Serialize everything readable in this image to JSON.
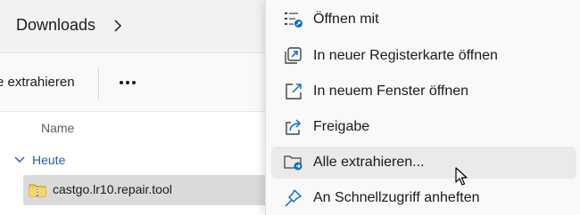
{
  "address_bar": {
    "current_folder": "Downloads",
    "chevron_icon": "chevron-right-icon"
  },
  "command_bar": {
    "extract_label": "e extrahieren",
    "more_icon": "more-dots-icon"
  },
  "file_list": {
    "column_name": "Name",
    "group_label": "Heute",
    "group_icon": "chevron-down-icon",
    "files": [
      {
        "name": "castgo.lr10.repair.tool",
        "icon": "zip-folder-icon",
        "selected": true
      }
    ]
  },
  "context_menu": {
    "items": [
      {
        "label": "Öffnen mit",
        "icon": "open-with-icon"
      },
      {
        "label": "In neuer Registerkarte öffnen",
        "icon": "new-tab-icon"
      },
      {
        "label": "In neuem Fenster öffnen",
        "icon": "new-window-icon"
      },
      {
        "label": "Freigabe",
        "icon": "share-icon"
      },
      {
        "label": "Alle extrahieren...",
        "icon": "extract-all-icon",
        "hovered": true
      },
      {
        "label": "An Schnellzugriff anheften",
        "icon": "pin-icon"
      }
    ]
  },
  "colors": {
    "accent": "#0f6cbd",
    "group_text": "#2b5d9b",
    "selection": "#dadada",
    "menu_hover": "#eaeaea",
    "zip_folder": "#f2c84b"
  }
}
